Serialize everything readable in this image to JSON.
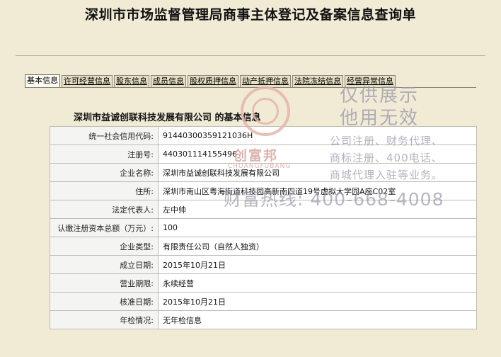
{
  "page": {
    "title": "深圳市市场监督管理局商事主体登记及备案信息查询单"
  },
  "tabs": [
    {
      "label": "基本信息",
      "active": true
    },
    {
      "label": "许可经营信息",
      "active": false
    },
    {
      "label": "股东信息",
      "active": false
    },
    {
      "label": "成员信息",
      "active": false
    },
    {
      "label": "股权质押信息",
      "active": false
    },
    {
      "label": "动产抵押信息",
      "active": false
    },
    {
      "label": "法院冻结信息",
      "active": false
    },
    {
      "label": "经营异常信息",
      "active": false
    }
  ],
  "company_heading": "深圳市益诚创联科技发展有限公司  的基本信息",
  "rows": [
    {
      "label": "统一社会信用代码:",
      "value": "91440300359121036H"
    },
    {
      "label": "注册号:",
      "value": "440301114155496"
    },
    {
      "label": "企业名称:",
      "value": "深圳市益诚创联科技发展有限公司"
    },
    {
      "label": "住所:",
      "value": "深圳市南山区粤海街道科技园高新南四道19号虚拟大学园A座C02室"
    },
    {
      "label": "法定代表人:",
      "value": "左中帅"
    },
    {
      "label": "认缴注册资本总额（万元）:",
      "value": "100"
    },
    {
      "label": "企业类型:",
      "value": "有限责任公司（自然人独资）"
    },
    {
      "label": "成立日期:",
      "value": "2015年10月21日"
    },
    {
      "label": "营业期限:",
      "value": "永续经营"
    },
    {
      "label": "核准日期:",
      "value": "2015年10月21日"
    },
    {
      "label": "年检情况:",
      "value": "无年检信息"
    }
  ],
  "watermark": {
    "brand": "创富邦",
    "brand_en": "CHUANGFUBANG",
    "line1": "仅供展示",
    "line2": "他用无效",
    "services": [
      "公司注册、财务代理、",
      "商标注册、400电话、",
      "商城代理入驻等业务。"
    ],
    "hotline": "财富热线: 400-668-4008"
  },
  "colors": {
    "background": "#f1ebd6",
    "tab_inactive": "#e6dfc6",
    "watermark_red": "#d9a7a0",
    "watermark_gray": "#9a98a8"
  }
}
